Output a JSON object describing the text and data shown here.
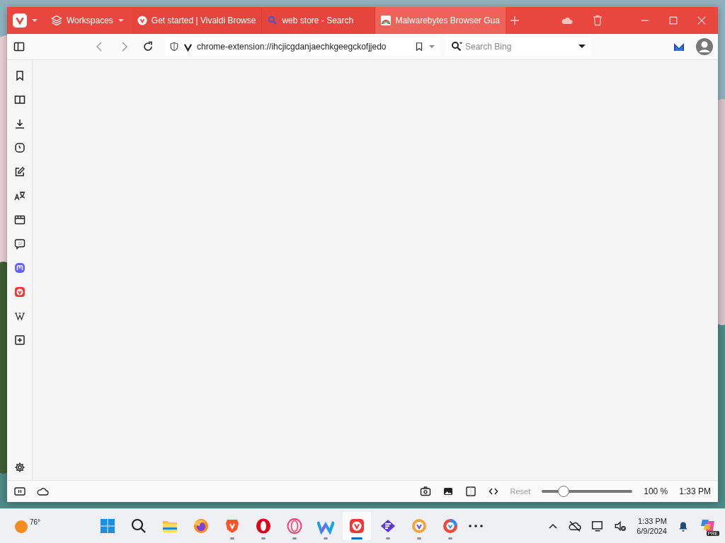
{
  "window": {
    "workspaces": "Workspaces",
    "tabs": [
      {
        "title": "Get started | Vivaldi Browse",
        "selected": false
      },
      {
        "title": "web store - Search",
        "selected": false
      },
      {
        "title": "Malwarebytes Browser Gua",
        "selected": true
      }
    ]
  },
  "address_bar": {
    "url": "chrome-extension://ihcjicgdanjaechkgeegckofjjedo"
  },
  "search": {
    "placeholder": "Search Bing"
  },
  "status_bar": {
    "reset": "Reset",
    "zoom": {
      "level": 0.2
    },
    "zoom_reading": "100 %",
    "clock": "1:33 PM"
  },
  "taskbar": {
    "weather": "76°",
    "apps": [
      {
        "running": false,
        "selected": false
      },
      {
        "running": false,
        "selected": false
      },
      {
        "running": false,
        "selected": false
      },
      {
        "running": false,
        "selected": false
      },
      {
        "running": true,
        "selected": false
      },
      {
        "running": true,
        "selected": false
      },
      {
        "running": true,
        "selected": false
      },
      {
        "running": true,
        "selected": false
      },
      {
        "running": true,
        "selected": true
      },
      {
        "running": true,
        "selected": false
      },
      {
        "running": true,
        "selected": false
      },
      {
        "running": true,
        "selected": false
      }
    ],
    "time": "1:33 PM",
    "date": "6/9/2024",
    "copilot_badge": "PRE"
  }
}
